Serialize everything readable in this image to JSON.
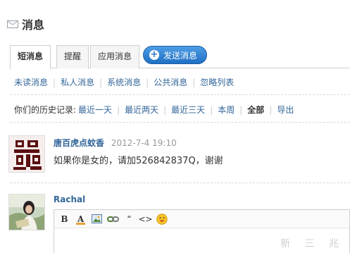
{
  "header": {
    "title": "消息",
    "icon": "mail-icon"
  },
  "tabs": [
    {
      "label": "短消息",
      "active": true
    },
    {
      "label": "提醒",
      "active": false
    },
    {
      "label": "应用消息",
      "active": false
    }
  ],
  "send_button": {
    "label": "发送消息",
    "icon": "plus-icon",
    "color": "#2a76c9"
  },
  "filters": [
    "未读消息",
    "私人消息",
    "系统消息",
    "公共消息",
    "忽略列表"
  ],
  "history": {
    "label": "你们的历史记录:",
    "options": [
      "最近一天",
      "最近两天",
      "最近三天",
      "本周",
      "全部",
      "导出"
    ],
    "current": "全部"
  },
  "message": {
    "user": "唐百虎点蚊香",
    "time": "2012-7-4 19:10",
    "text": "如果你是女的，请加526842837Q，谢谢",
    "avatar": "calligraphy-avatar"
  },
  "reply": {
    "user": "Rachal",
    "avatar": "photo-avatar",
    "toolbar": [
      "B",
      "A",
      "image-icon",
      "link-icon",
      "“",
      "<>",
      "smiley-icon"
    ]
  },
  "watermark": "新 三 兆",
  "colors": {
    "link": "#336699",
    "accent": "#2a76c9"
  }
}
